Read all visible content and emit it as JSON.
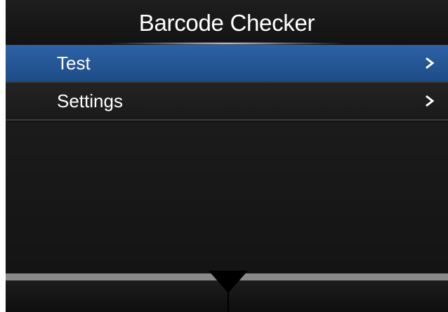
{
  "header": {
    "title": "Barcode Checker"
  },
  "menu": {
    "items": [
      {
        "label": "Test",
        "selected": true
      },
      {
        "label": "Settings",
        "selected": false
      }
    ]
  },
  "icons": {
    "item_arrow": "chevron-right-icon",
    "scroll": "down-arrow-icon"
  },
  "colors": {
    "selected_row": "#2a5f9e",
    "background": "#161616",
    "text": "#ffffff"
  }
}
